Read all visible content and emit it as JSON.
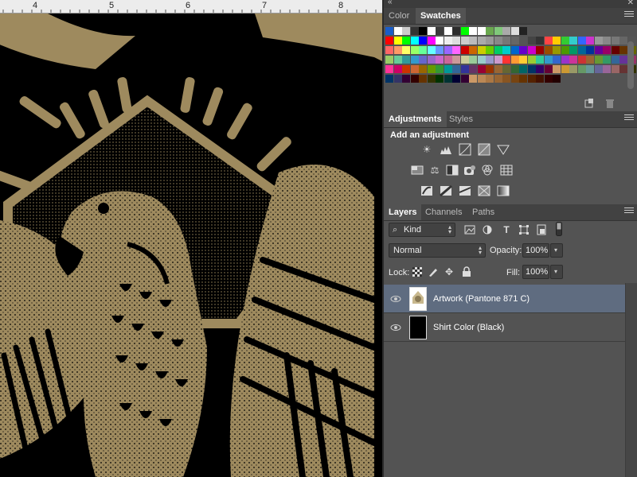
{
  "ruler": {
    "marks": [
      "4",
      "5",
      "6",
      "7",
      "8"
    ]
  },
  "colors": {
    "panel_bg": "#535353",
    "tab_bar": "#424242",
    "selection": "#5f6c80",
    "artwork_tan": "#9e8a5e"
  },
  "swatches_panel": {
    "tabs": [
      {
        "label": "Color",
        "active": false
      },
      {
        "label": "Swatches",
        "active": true
      }
    ],
    "rows": [
      [
        "#1a5dc8",
        "#ffffff",
        "#cccccc",
        "#333333",
        "#000000",
        "#ffffff",
        "#3b3b3b",
        "#ffffff",
        "#2c2c2c",
        "#00ff00",
        "#ffffff",
        "#ffffff",
        "#6aa84f",
        "#80c87a",
        "#aaaaaa",
        "#dddddd",
        "#222222"
      ],
      [
        "#ff0000",
        "#ffff00",
        "#00ff00",
        "#00ffff",
        "#0000ff",
        "#ff00ff",
        "#ffffff",
        "#eeeeee",
        "#dddddd",
        "#cccccc",
        "#bbbbbb",
        "#aaaaaa",
        "#999999",
        "#888888",
        "#777777",
        "#666666",
        "#555555",
        "#444444",
        "#333333",
        "#ff4444",
        "#ffcc00",
        "#33cc33",
        "#33cccc",
        "#3366ff",
        "#cc33cc",
        "#999999",
        "#888888",
        "#777777",
        "#666666",
        "#555555"
      ],
      [
        "#ff6666",
        "#ff9966",
        "#ffff66",
        "#99ff66",
        "#66ff99",
        "#66ffff",
        "#6699ff",
        "#9966ff",
        "#ff66ff",
        "#cc0000",
        "#cc6600",
        "#cccc00",
        "#66cc00",
        "#00cc66",
        "#00cccc",
        "#0066cc",
        "#6600cc",
        "#cc00cc",
        "#990000",
        "#994c00",
        "#999900",
        "#4c9900",
        "#009966",
        "#006699",
        "#003399",
        "#660099",
        "#990066",
        "#660000",
        "#663300",
        "#666600"
      ],
      [
        "#99cc66",
        "#66cc99",
        "#339999",
        "#3399cc",
        "#6666cc",
        "#9966cc",
        "#cc66cc",
        "#cc6699",
        "#cc9999",
        "#cccc99",
        "#99cc99",
        "#99cccc",
        "#9999cc",
        "#cc99cc",
        "#ff3333",
        "#ff9933",
        "#ffcc33",
        "#99cc33",
        "#33cc99",
        "#3399cc",
        "#3366cc",
        "#9933cc",
        "#cc3399",
        "#cc3333",
        "#996633",
        "#669933",
        "#339966",
        "#336699",
        "#663399",
        "#993366"
      ],
      [
        "#ff3399",
        "#cc0066",
        "#cc3300",
        "#cc6633",
        "#996600",
        "#669900",
        "#339933",
        "#009999",
        "#336699",
        "#333399",
        "#663366",
        "#990033",
        "#993300",
        "#996633",
        "#666633",
        "#336633",
        "#006666",
        "#003366",
        "#330066",
        "#660033",
        "#cc9966",
        "#cc9933",
        "#999966",
        "#669966",
        "#669999",
        "#666699",
        "#996699",
        "#996666",
        "#663333",
        "#333300"
      ],
      [
        "#003366",
        "#333366",
        "#330033",
        "#330000",
        "#663300",
        "#333300",
        "#003300",
        "#003333",
        "#000033",
        "#330033",
        "#cc9966",
        "#bb8855",
        "#aa7744",
        "#996633",
        "#885522",
        "#774411",
        "#663300",
        "#552200",
        "#441100",
        "#330000",
        "#220000"
      ]
    ],
    "footer_icons": [
      "new-swatch-icon",
      "trash-icon"
    ]
  },
  "adjustments_panel": {
    "tabs": [
      {
        "label": "Adjustments",
        "active": true
      },
      {
        "label": "Styles",
        "active": false
      }
    ],
    "title": "Add an adjustment",
    "icon_rows": [
      [
        "brightness-contrast-icon",
        "levels-icon",
        "curves-icon",
        "exposure-icon",
        "vibrance-icon"
      ],
      [
        "hue-saturation-icon",
        "color-balance-icon",
        "black-white-icon",
        "photo-filter-icon",
        "channel-mixer-icon",
        "color-lookup-icon"
      ],
      [
        "invert-icon",
        "posterize-icon",
        "threshold-icon",
        "selective-color-icon",
        "gradient-map-icon"
      ]
    ]
  },
  "layers_panel": {
    "tabs": [
      {
        "label": "Layers",
        "active": true
      },
      {
        "label": "Channels",
        "active": false
      },
      {
        "label": "Paths",
        "active": false
      }
    ],
    "filter_kind": "Kind",
    "filter_icons": [
      "pixel-filter-icon",
      "adjustment-filter-icon",
      "type-filter-icon",
      "shape-filter-icon",
      "smart-object-filter-icon"
    ],
    "blend_mode": "Normal",
    "opacity_label": "Opacity:",
    "opacity_value": "100%",
    "lock_label": "Lock:",
    "lock_icons": [
      "lock-transparency-icon",
      "lock-paint-icon",
      "lock-position-icon",
      "lock-all-icon"
    ],
    "fill_label": "Fill:",
    "fill_value": "100%",
    "layers": [
      {
        "name": "Artwork (Pantone 871 C)",
        "selected": true,
        "visible": true
      },
      {
        "name": "Shirt Color (Black)",
        "selected": false,
        "visible": true
      }
    ]
  }
}
